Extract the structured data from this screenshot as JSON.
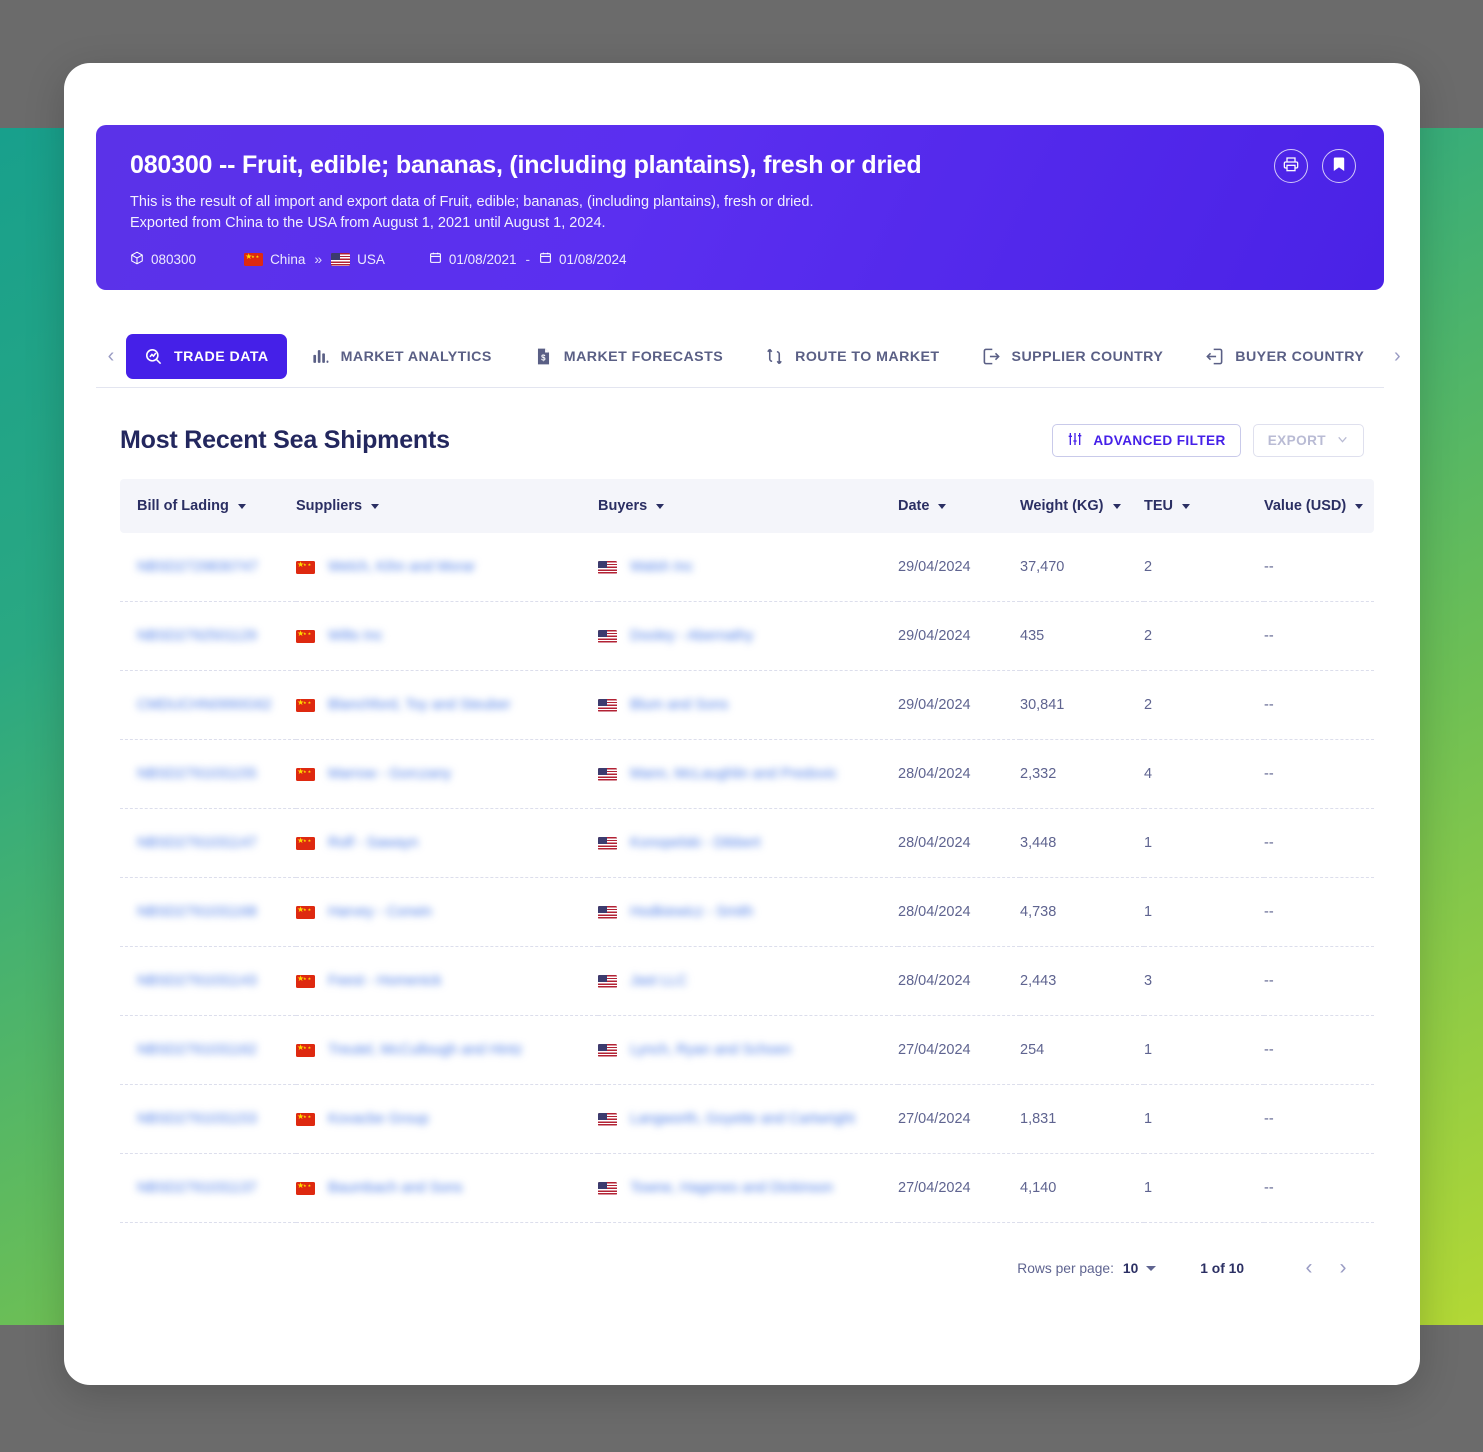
{
  "banner": {
    "title": "080300 -- Fruit, edible; bananas, (including plantains), fresh or dried",
    "description_line1": "This is the result of all import and export data of Fruit, edible; bananas, (including plantains), fresh or dried.",
    "description_line2": "Exported from China to the USA from August 1, 2021 until August 1, 2024.",
    "meta": {
      "hs_code": "080300",
      "origin_country": "China",
      "arrow": "»",
      "destination_country": "USA",
      "date_from": "01/08/2021",
      "date_separator": "-",
      "date_to": "01/08/2024"
    },
    "actions": {
      "print": "print-icon",
      "bookmark": "bookmark-icon"
    },
    "accent_color": "#4520e8"
  },
  "tabs": {
    "prev_arrow": "‹",
    "next_arrow": "›",
    "items": [
      {
        "label": "TRADE DATA",
        "icon": "search-data-icon",
        "active": true
      },
      {
        "label": "MARKET ANALYTICS",
        "icon": "bar-chart-icon",
        "active": false
      },
      {
        "label": "MARKET FORECASTS",
        "icon": "document-dollar-icon",
        "active": false
      },
      {
        "label": "ROUTE TO MARKET",
        "icon": "route-icon",
        "active": false
      },
      {
        "label": "SUPPLIER COUNTRY",
        "icon": "export-arrow-icon",
        "active": false
      },
      {
        "label": "BUYER COUNTRY",
        "icon": "import-arrow-icon",
        "active": false
      }
    ]
  },
  "table_section": {
    "title": "Most Recent Sea Shipments",
    "advanced_filter_label": "ADVANCED FILTER",
    "export_label": "EXPORT",
    "columns": [
      {
        "label": "Bill of Lading",
        "key": "bol",
        "sortable": true
      },
      {
        "label": "Suppliers",
        "key": "sup",
        "sortable": true
      },
      {
        "label": "Buyers",
        "key": "buy",
        "sortable": true
      },
      {
        "label": "Date",
        "key": "date",
        "sortable": true
      },
      {
        "label": "Weight (KG)",
        "key": "weight",
        "sortable": true
      },
      {
        "label": "TEU",
        "key": "teu",
        "sortable": true
      },
      {
        "label": "Value (USD)",
        "key": "value",
        "sortable": true
      }
    ],
    "rows": [
      {
        "bol": "NBSD2729830747",
        "supplier": "Welch, Kihn and Morar",
        "supplier_flag": "CN",
        "buyer": "Walsh Inc",
        "buyer_flag": "US",
        "date": "29/04/2024",
        "weight": "37,470",
        "teu": "2",
        "value": "--"
      },
      {
        "bol": "NBSD2792501129",
        "supplier": "Wilts Inc",
        "supplier_flag": "CN",
        "buyer": "Dooley - Abernathy",
        "buyer_flag": "US",
        "date": "29/04/2024",
        "weight": "435",
        "teu": "2",
        "value": "--"
      },
      {
        "bol": "CMDUCHN0990G62",
        "supplier": "Blanchford, Toy and Steuber",
        "supplier_flag": "CN",
        "buyer": "Blum and Sons",
        "buyer_flag": "US",
        "date": "29/04/2024",
        "weight": "30,841",
        "teu": "2",
        "value": "--"
      },
      {
        "bol": "NBSD2791031155",
        "supplier": "Marrow - Gorczany",
        "supplier_flag": "CN",
        "buyer": "Mann, McLaughlin and Predovic",
        "buyer_flag": "US",
        "date": "28/04/2024",
        "weight": "2,332",
        "teu": "4",
        "value": "--"
      },
      {
        "bol": "NBSD2791031147",
        "supplier": "Rolf - Sawayn",
        "supplier_flag": "CN",
        "buyer": "Konopelski - Dibbert",
        "buyer_flag": "US",
        "date": "28/04/2024",
        "weight": "3,448",
        "teu": "1",
        "value": "--"
      },
      {
        "bol": "NBSD2791031168",
        "supplier": "Harvey - Corwin",
        "supplier_flag": "CN",
        "buyer": "Hodkiewicz - Smith",
        "buyer_flag": "US",
        "date": "28/04/2024",
        "weight": "4,738",
        "teu": "1",
        "value": "--"
      },
      {
        "bol": "NBSD2791031143",
        "supplier": "Feest - Homenick",
        "supplier_flag": "CN",
        "buyer": "Jast LLC",
        "buyer_flag": "US",
        "date": "28/04/2024",
        "weight": "2,443",
        "teu": "3",
        "value": "--"
      },
      {
        "bol": "NBSD2791031162",
        "supplier": "Treutel, McCullough and Hintz",
        "supplier_flag": "CN",
        "buyer": "Lynch, Ryan and Schoen",
        "buyer_flag": "US",
        "date": "27/04/2024",
        "weight": "254",
        "teu": "1",
        "value": "--"
      },
      {
        "bol": "NBSD2791031153",
        "supplier": "Kovacbe Group",
        "supplier_flag": "CN",
        "buyer": "Langworth, Goyette and Cartwright",
        "buyer_flag": "US",
        "date": "27/04/2024",
        "weight": "1,831",
        "teu": "1",
        "value": "--"
      },
      {
        "bol": "NBSD2791031137",
        "supplier": "Baumbach and Sons",
        "supplier_flag": "CN",
        "buyer": "Towne, Hagenes and Dickinson",
        "buyer_flag": "US",
        "date": "27/04/2024",
        "weight": "4,140",
        "teu": "1",
        "value": "--"
      }
    ]
  },
  "pagination": {
    "rows_per_page_label": "Rows per page:",
    "rows_per_page_value": "10",
    "page_indicator": "1 of 10",
    "prev_arrow": "‹",
    "next_arrow": "›"
  }
}
